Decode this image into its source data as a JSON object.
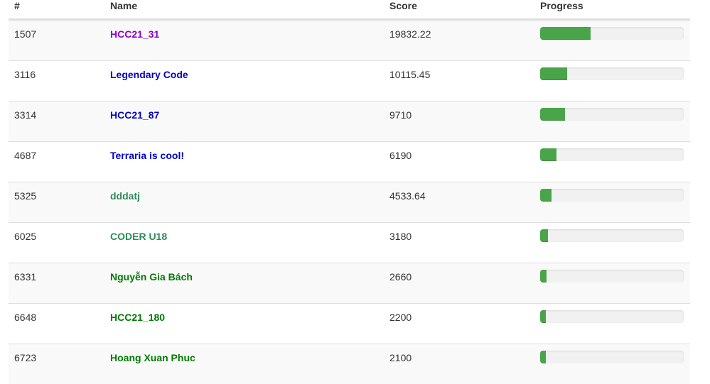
{
  "header": {
    "rank_label": "#",
    "name_label": "Name",
    "score_label": "Score",
    "progress_label": "Progress"
  },
  "rows": [
    {
      "rank": "1507",
      "name": "HCC21_31",
      "score": "19832.22",
      "progress_percent": 35,
      "name_color": "#8b00c8"
    },
    {
      "rank": "3116",
      "name": "Legendary Code",
      "score": "10115.45",
      "progress_percent": 19,
      "name_color": "#0000c8"
    },
    {
      "rank": "3314",
      "name": "HCC21_87",
      "score": "9710",
      "progress_percent": 17.5,
      "name_color": "#0000c8"
    },
    {
      "rank": "4687",
      "name": "Terraria is cool!",
      "score": "6190",
      "progress_percent": 11.5,
      "name_color": "#0000c8"
    },
    {
      "rank": "5325",
      "name": "dddatj",
      "score": "4533.64",
      "progress_percent": 8,
      "name_color": "#2e8b57"
    },
    {
      "rank": "6025",
      "name": "CODER U18",
      "score": "3180",
      "progress_percent": 5.5,
      "name_color": "#2e8b57"
    },
    {
      "rank": "6331",
      "name": "Nguyễn Gia Bách",
      "score": "2660",
      "progress_percent": 4.5,
      "name_color": "#007a00"
    },
    {
      "rank": "6648",
      "name": "HCC21_180",
      "score": "2200",
      "progress_percent": 4,
      "name_color": "#007a00"
    },
    {
      "rank": "6723",
      "name": "Hoang Xuan Phuc",
      "score": "2100",
      "progress_percent": 4,
      "name_color": "#007a00"
    }
  ],
  "colors": {
    "progress_fill": "#4aa54a",
    "progress_track": "#f1f1f1",
    "stripe": "#f9f9f9"
  }
}
